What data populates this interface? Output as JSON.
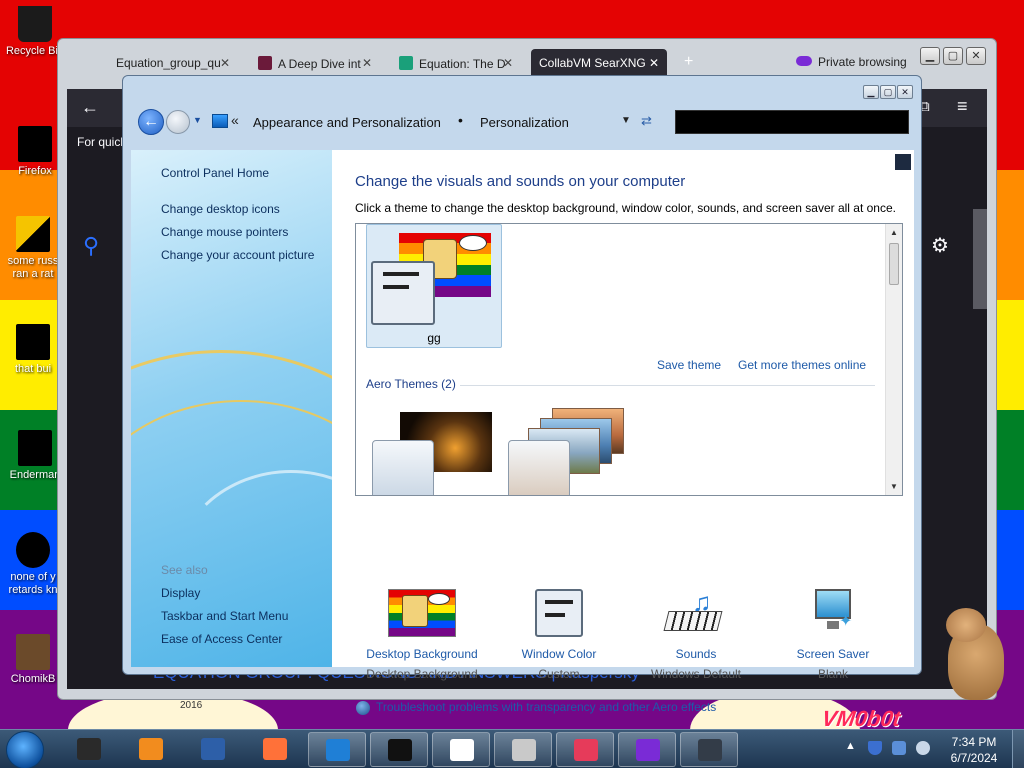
{
  "desktop": {
    "icons": [
      {
        "label": "Recycle Bin",
        "name": "desktop-icon-recycle-bin"
      },
      {
        "label": "Firefox",
        "name": "desktop-icon-firefox"
      },
      {
        "label": "some russ",
        "label2": "ran a rat",
        "name": "desktop-icon-some-russian"
      },
      {
        "label": "that bui",
        "name": "desktop-icon-that-bui"
      },
      {
        "label": "Enderman",
        "name": "desktop-icon-enderman"
      },
      {
        "label": "none of y",
        "label2": "retards kn",
        "name": "desktop-icon-none-of-you"
      },
      {
        "label": "ChomikB",
        "name": "desktop-icon-chomik"
      }
    ],
    "watermark": "VM0b0t",
    "year_text": "2016"
  },
  "firefox": {
    "tabs": [
      {
        "label": "Equation_group_qu",
        "active": false
      },
      {
        "label": "A Deep Dive int",
        "active": false
      },
      {
        "label": "Equation: The D",
        "active": false
      },
      {
        "label": "CollabVM SearXNG",
        "active": true
      }
    ],
    "new_tab": "+",
    "private_browsing": "Private browsing",
    "quick_text": "For quick",
    "footer_text": "EQUATION GROUP: QUESTIONS AND ANSWERS | Kaspersky",
    "colors": {
      "tabbar": "#cfd4da",
      "content": "#1c1b22",
      "accent": "#2b6fff"
    }
  },
  "control_panel": {
    "breadcrumb": [
      "Appearance and Personalization",
      "Personalization"
    ],
    "left_links": [
      "Control Panel Home",
      "Change desktop icons",
      "Change mouse pointers",
      "Change your account picture"
    ],
    "see_also_label": "See also",
    "see_also_links": [
      "Display",
      "Taskbar and Start Menu",
      "Ease of Access Center"
    ],
    "title": "Change the visuals and sounds on your computer",
    "subtitle": "Click a theme to change the desktop background, window color, sounds, and screen saver all at once.",
    "my_theme_name": "gg",
    "save_theme": "Save theme",
    "get_more_themes": "Get more themes online",
    "aero_heading": "Aero Themes (2)",
    "bottom_items": [
      {
        "title": "Desktop Background",
        "subtitle": "Desktop Background",
        "icon": "desktop-background-icon"
      },
      {
        "title": "Window Color",
        "subtitle": "Custom",
        "icon": "window-color-icon"
      },
      {
        "title": "Sounds",
        "subtitle": "Windows Default",
        "icon": "sounds-icon"
      },
      {
        "title": "Screen Saver",
        "subtitle": "Blank",
        "icon": "screen-saver-icon"
      }
    ],
    "troubleshoot": "Troubleshoot problems with transparency and other Aero effects"
  },
  "taskbar": {
    "time": "7:34 PM",
    "date": "6/7/2024",
    "buttons": [
      {
        "name": "taskbar-app-terminal",
        "color": "#2a2a2a",
        "state": "pinned"
      },
      {
        "name": "taskbar-app-media-player",
        "color": "#f28c1e",
        "state": "pinned"
      },
      {
        "name": "taskbar-app-globe",
        "color": "#2d5fa8",
        "state": "pinned"
      },
      {
        "name": "taskbar-app-firefox",
        "color": "#ff7139",
        "state": "pinned"
      },
      {
        "name": "taskbar-app-control-panel",
        "color": "#1f7fd6",
        "state": "open"
      },
      {
        "name": "taskbar-app-dark-window",
        "color": "#111111",
        "state": "open"
      },
      {
        "name": "taskbar-app-7zip",
        "color": "#ffffff",
        "state": "open"
      },
      {
        "name": "taskbar-app-clipboard",
        "color": "#c9c9c9",
        "state": "open"
      },
      {
        "name": "taskbar-app-paint",
        "color": "#e63b5a",
        "state": "open"
      },
      {
        "name": "taskbar-app-private-firefox",
        "color": "#7a2bd6",
        "state": "open"
      },
      {
        "name": "taskbar-app-monitor",
        "color": "#333c48",
        "state": "open"
      }
    ]
  }
}
